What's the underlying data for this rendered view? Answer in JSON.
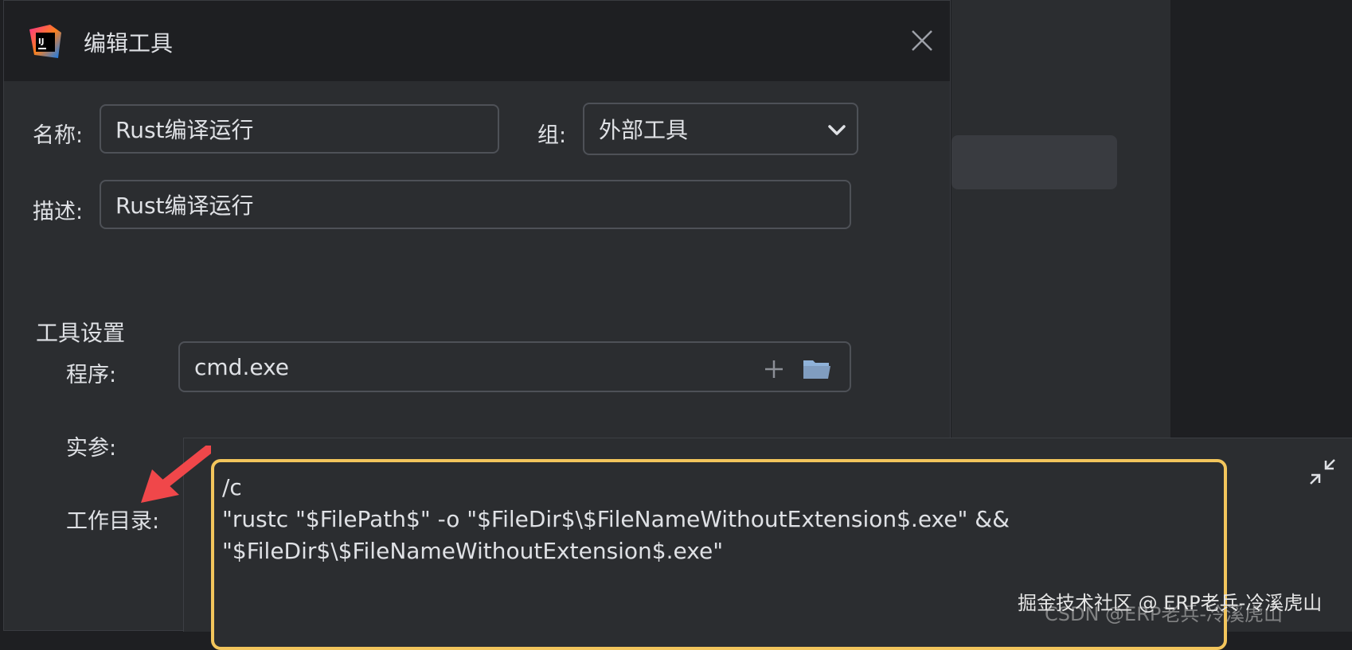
{
  "window": {
    "title": "编辑工具"
  },
  "form": {
    "name_label": "名称:",
    "name_value": "Rust编译运行",
    "group_label": "组:",
    "group_value": "外部工具",
    "description_label": "描述:",
    "description_value": "Rust编译运行"
  },
  "tool_settings": {
    "section_title": "工具设置",
    "program_label": "程序:",
    "program_value": "cmd.exe",
    "arguments_label": "实参:",
    "working_dir_label": "工作目录:"
  },
  "arguments_editor": {
    "lines": [
      "/c",
      "\"rustc \"$FilePath$\" -o \"$FileDir$\\$FileNameWithoutExtension$.exe\" &&",
      "\"$FileDir$\\$FileNameWithoutExtension$.exe\""
    ]
  },
  "watermark": {
    "primary": "掘金技术社区 @ ERP老兵-冷溪虎山",
    "secondary": "CSDN @ERP老兵-冷溪虎山"
  },
  "colors": {
    "background": "#2b2d30",
    "titlebar": "#1e1f22",
    "field_border": "#4e5157",
    "focus_border": "#f2c55c",
    "arrow": "#f0474a",
    "folder_icon": "#8fb2d9"
  }
}
